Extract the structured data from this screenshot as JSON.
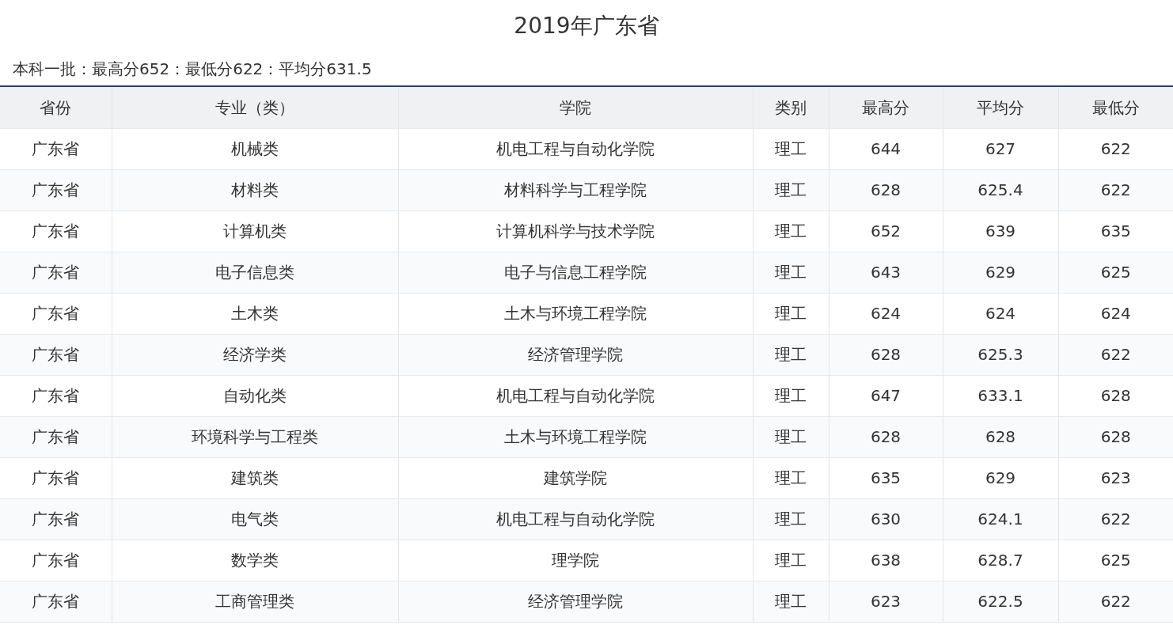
{
  "title": "2019年广东省",
  "summary": "本科一批：最高分652：最低分622：平均分631.5",
  "table": {
    "columns": [
      "省份",
      "专业（类）",
      "学院",
      "类别",
      "最高分",
      "平均分",
      "最低分"
    ],
    "rows": [
      [
        "广东省",
        "机械类",
        "机电工程与自动化学院",
        "理工",
        "644",
        "627",
        "622"
      ],
      [
        "广东省",
        "材料类",
        "材料科学与工程学院",
        "理工",
        "628",
        "625.4",
        "622"
      ],
      [
        "广东省",
        "计算机类",
        "计算机科学与技术学院",
        "理工",
        "652",
        "639",
        "635"
      ],
      [
        "广东省",
        "电子信息类",
        "电子与信息工程学院",
        "理工",
        "643",
        "629",
        "625"
      ],
      [
        "广东省",
        "土木类",
        "土木与环境工程学院",
        "理工",
        "624",
        "624",
        "624"
      ],
      [
        "广东省",
        "经济学类",
        "经济管理学院",
        "理工",
        "628",
        "625.3",
        "622"
      ],
      [
        "广东省",
        "自动化类",
        "机电工程与自动化学院",
        "理工",
        "647",
        "633.1",
        "628"
      ],
      [
        "广东省",
        "环境科学与工程类",
        "土木与环境工程学院",
        "理工",
        "628",
        "628",
        "628"
      ],
      [
        "广东省",
        "建筑类",
        "建筑学院",
        "理工",
        "635",
        "629",
        "623"
      ],
      [
        "广东省",
        "电气类",
        "机电工程与自动化学院",
        "理工",
        "630",
        "624.1",
        "622"
      ],
      [
        "广东省",
        "数学类",
        "理学院",
        "理工",
        "638",
        "628.7",
        "625"
      ],
      [
        "广东省",
        "工商管理类",
        "经济管理学院",
        "理工",
        "623",
        "622.5",
        "622"
      ]
    ]
  }
}
